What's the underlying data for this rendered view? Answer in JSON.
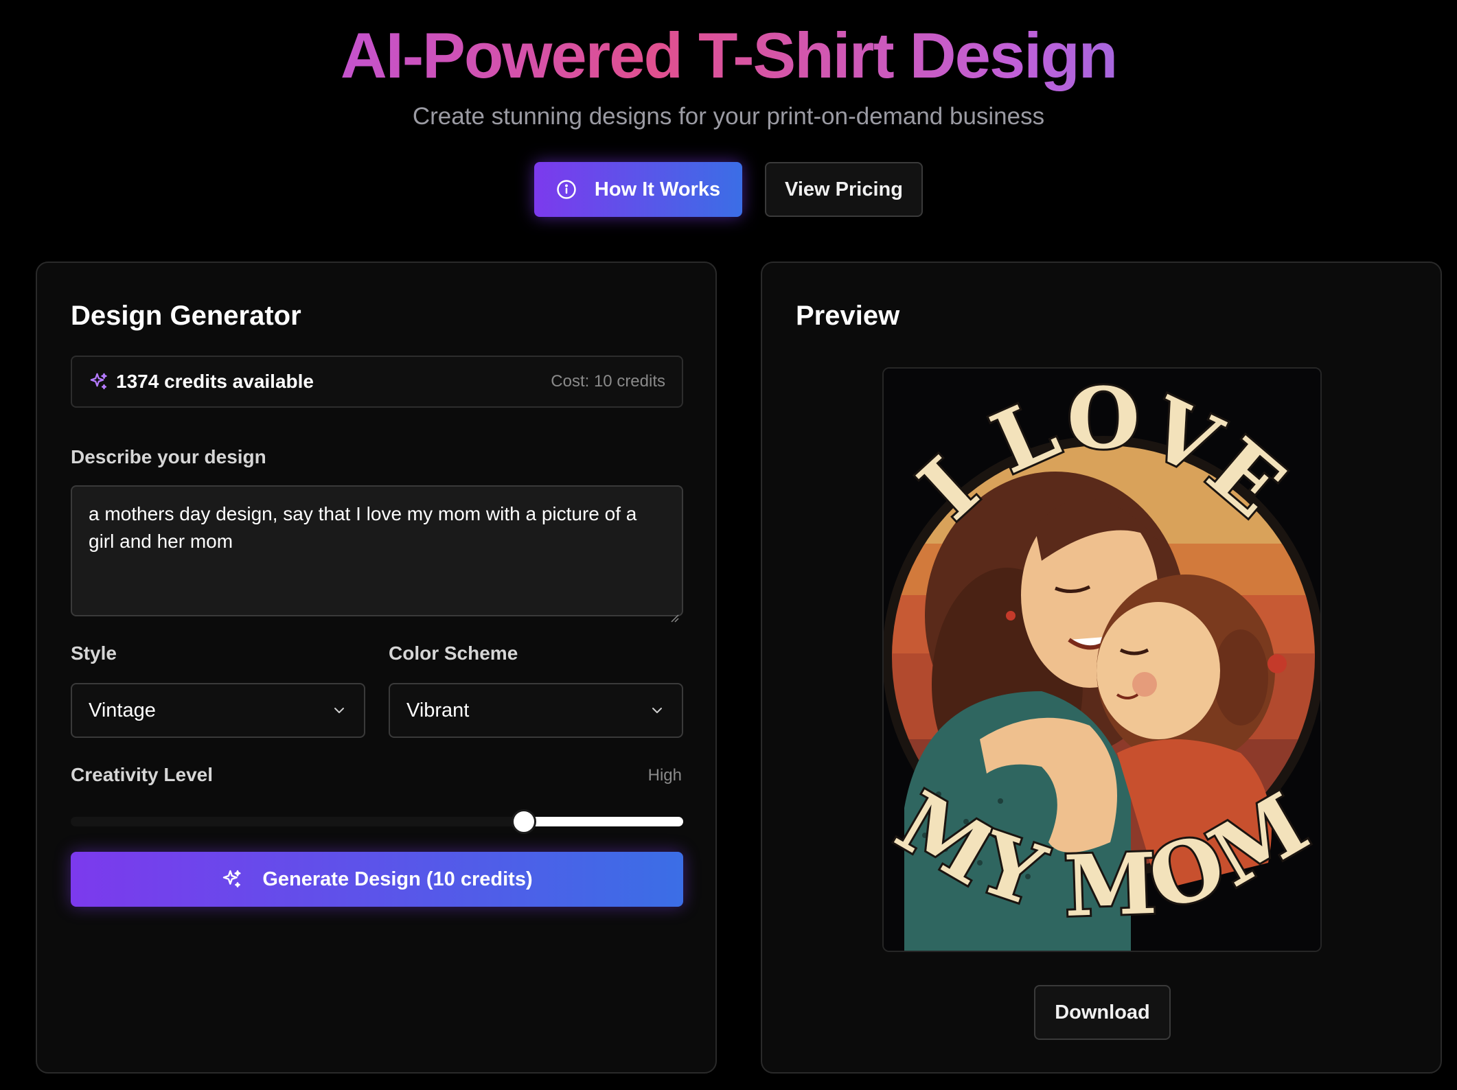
{
  "header": {
    "title": "AI-Powered T-Shirt Design",
    "subtitle": "Create stunning designs for your print-on-demand business",
    "how_it_works_label": "How It Works",
    "view_pricing_label": "View Pricing"
  },
  "generator": {
    "title": "Design Generator",
    "credits_text": "1374 credits available",
    "cost_text": "Cost: 10 credits",
    "describe_label": "Describe your design",
    "prompt_value": "a mothers day design, say that I love my mom with a picture of a girl and her mom",
    "style_label": "Style",
    "style_value": "Vintage",
    "color_scheme_label": "Color Scheme",
    "color_scheme_value": "Vibrant",
    "creativity_label": "Creativity Level",
    "creativity_level_text": "High",
    "creativity_value": 0.74,
    "generate_label": "Generate Design (10 credits)"
  },
  "preview": {
    "title": "Preview",
    "artwork_text_top": "I LOVE",
    "artwork_text_bottom": "MY MOM",
    "download_label": "Download"
  },
  "colors": {
    "accent_start": "#7c3aed",
    "accent_end": "#3b6ee6",
    "background": "#000000",
    "card": "#0b0b0b"
  }
}
